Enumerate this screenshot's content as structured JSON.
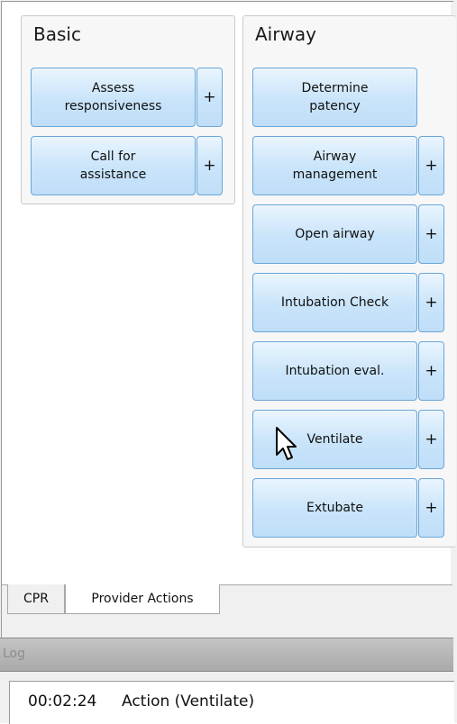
{
  "groups": {
    "basic": {
      "title": "Basic",
      "buttons": [
        {
          "label": "Assess\nresponsiveness",
          "plus": "+"
        },
        {
          "label": "Call for\nassistance",
          "plus": "+"
        }
      ]
    },
    "airway": {
      "title": "Airway",
      "buttons": [
        {
          "label": "Determine\npatency"
        },
        {
          "label": "Airway\nmanagement",
          "plus": "+"
        },
        {
          "label": "Open airway",
          "plus": "+"
        },
        {
          "label": "Intubation Check",
          "plus": "+"
        },
        {
          "label": "Intubation eval.",
          "plus": "+"
        },
        {
          "label": "Ventilate",
          "plus": "+"
        },
        {
          "label": "Extubate",
          "plus": "+"
        }
      ]
    }
  },
  "tabs": [
    {
      "label": "CPR",
      "active": false
    },
    {
      "label": "Provider Actions",
      "active": true
    }
  ],
  "log": {
    "title": "Log",
    "entry": {
      "time": "00:02:24",
      "text": "Action (Ventilate)"
    }
  },
  "colors": {
    "button_border": "#6aa6d8",
    "button_fill_top": "#eaf5fe",
    "button_fill_bottom": "#bfdef8",
    "log_header": "#b5b5b5"
  },
  "icons": {
    "cursor": "arrow-pointer-icon"
  }
}
